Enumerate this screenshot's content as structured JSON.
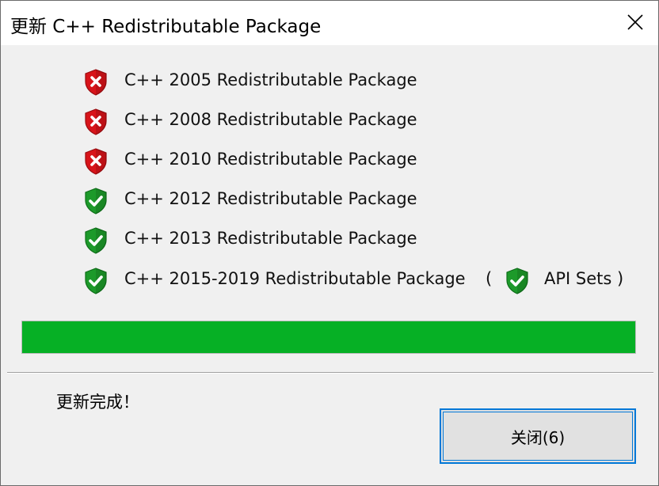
{
  "window": {
    "title": "更新 C++ Redistributable Package",
    "close_icon": "close-x-icon"
  },
  "packages": [
    {
      "label": "C++ 2005 Redistributable Package",
      "status": "failed",
      "icon": "shield-x-icon"
    },
    {
      "label": "C++ 2008 Redistributable Package",
      "status": "failed",
      "icon": "shield-x-icon"
    },
    {
      "label": "C++ 2010 Redistributable Package",
      "status": "failed",
      "icon": "shield-x-icon"
    },
    {
      "label": "C++ 2012 Redistributable Package",
      "status": "ok",
      "icon": "shield-check-icon"
    },
    {
      "label": "C++ 2013 Redistributable Package",
      "status": "ok",
      "icon": "shield-check-icon"
    },
    {
      "label": "C++ 2015-2019 Redistributable Package",
      "status": "ok",
      "icon": "shield-check-icon"
    }
  ],
  "api_sets": {
    "open_paren": "(",
    "label": "API Sets )",
    "status": "ok",
    "icon": "shield-check-icon"
  },
  "progress": {
    "percent": 100,
    "color": "#06b025"
  },
  "status_text": "更新完成！",
  "close_button": {
    "label": "关闭(6)"
  },
  "colors": {
    "fail_red": "#d8141a",
    "ok_green": "#1d9a2a",
    "focus_blue": "#0078d7"
  }
}
